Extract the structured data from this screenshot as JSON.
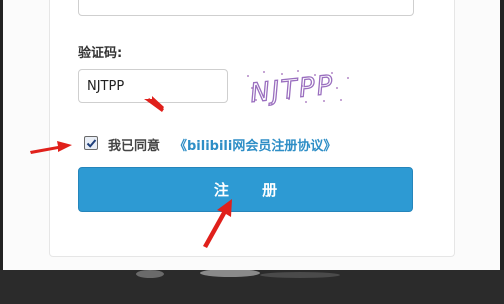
{
  "form": {
    "captcha_label": "验证码:",
    "captcha_value": "NJTPP",
    "captcha_image_text": "NJTPP",
    "agree_checked": true,
    "agree_text": "我已同意",
    "agree_link": "《bilibili网会员注册协议》",
    "register_label": "注 册"
  },
  "colors": {
    "accent": "#2d9ad3",
    "link": "#2e8ec6",
    "annotation_arrow": "#e0201b"
  },
  "icons": {
    "checkbox": "check-icon",
    "annotation": "red-arrow-icon"
  }
}
